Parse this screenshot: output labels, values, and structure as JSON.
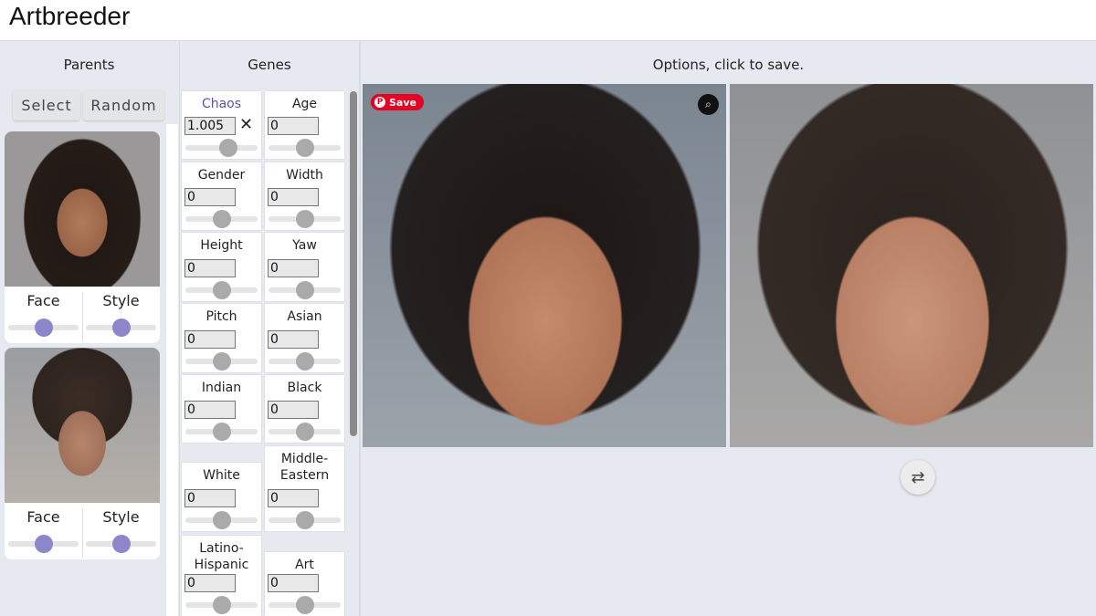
{
  "app": {
    "title": "Artbreeder"
  },
  "parents": {
    "title": "Parents",
    "select_label": "Select",
    "random_label": "Random",
    "items": [
      {
        "face_label": "Face",
        "style_label": "Style",
        "face_value": 0.5,
        "style_value": 0.5
      },
      {
        "face_label": "Face",
        "style_label": "Style",
        "face_value": 0.5,
        "style_value": 0.5
      }
    ]
  },
  "genes": {
    "title": "Genes",
    "clear_icon": "close-icon",
    "items": [
      {
        "label": "Chaos",
        "value": "1.005",
        "slider": 0.6,
        "highlight": true
      },
      {
        "label": "Age",
        "value": "0",
        "slider": 0.5
      },
      {
        "label": "Gender",
        "value": "0",
        "slider": 0.5
      },
      {
        "label": "Width",
        "value": "0",
        "slider": 0.5
      },
      {
        "label": "Height",
        "value": "0",
        "slider": 0.5
      },
      {
        "label": "Yaw",
        "value": "0",
        "slider": 0.5
      },
      {
        "label": "Pitch",
        "value": "0",
        "slider": 0.5
      },
      {
        "label": "Asian",
        "value": "0",
        "slider": 0.5
      },
      {
        "label": "Indian",
        "value": "0",
        "slider": 0.5
      },
      {
        "label": "Black",
        "value": "0",
        "slider": 0.5
      },
      {
        "label": "White",
        "value": "0",
        "slider": 0.5
      },
      {
        "label": "Middle-\nEastern",
        "value": "0",
        "slider": 0.5
      },
      {
        "label": "Latino-\nHispanic",
        "value": "0",
        "slider": 0.5
      },
      {
        "label": "Art",
        "value": "0",
        "slider": 0.5
      }
    ]
  },
  "main": {
    "title": "Options, click to save.",
    "pin_save_label": "Save",
    "lens_icon": "visual-search-icon",
    "regenerate_icon": "repeat-icon"
  },
  "colors": {
    "accent": "#8e86cc",
    "chaos": "#5b4fa8",
    "pinterest": "#e60023"
  }
}
